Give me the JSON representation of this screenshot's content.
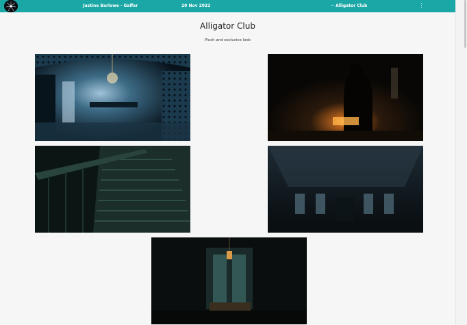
{
  "header": {
    "credit": "Justine Barlowe - Gaffer",
    "date": "20 Nov 2022",
    "section": "~ Alligator Club",
    "menu_glyph": "⋮",
    "logo_icon": "starburst-logo-icon",
    "menu_icon": "vertical-dots-icon",
    "accent_color": "#1ba7a6"
  },
  "page": {
    "title": "Alligator Club",
    "subtitle": "Plush and exclusive look"
  }
}
